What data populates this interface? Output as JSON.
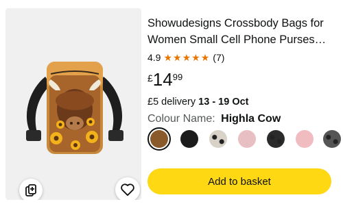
{
  "product": {
    "title_line1": "Showudesigns Crossbody Bags for",
    "title_line2": "Women Small Cell Phone Purses…",
    "rating": "4.9",
    "stars": 5,
    "review_count": "(7)",
    "price": {
      "currency": "£",
      "whole": "14",
      "fraction": "99"
    },
    "delivery": {
      "prefix": "£5 delivery",
      "dates": "13 - 19 Oct"
    },
    "colour": {
      "label": "Colour Name:",
      "value": "Highla Cow"
    },
    "swatches": [
      {
        "name": "highland-cow",
        "color": "#8b5a2b",
        "selected": true
      },
      {
        "name": "black",
        "color": "#1c1c1c",
        "selected": false
      },
      {
        "name": "cow-print",
        "color": "#d9d2c8",
        "selected": false
      },
      {
        "name": "pink-cow",
        "color": "#e8c0c4",
        "selected": false
      },
      {
        "name": "black-cow",
        "color": "#2b2b2b",
        "selected": false
      },
      {
        "name": "pink",
        "color": "#f0bcc0",
        "selected": false
      },
      {
        "name": "pattern",
        "color": "#555555",
        "selected": false
      }
    ],
    "add_to_basket_label": "Add to basket"
  },
  "colors": {
    "accent_button": "#ffd814",
    "star": "#e77600",
    "image_background": "#f0f0f0"
  },
  "icons": [
    "compare-icon",
    "heart-icon",
    "star-icon"
  ]
}
